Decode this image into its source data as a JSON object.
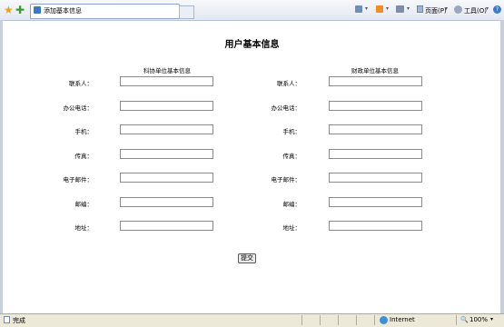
{
  "browser": {
    "tab_title": "添加基本信息",
    "page_menu": "页面(P)",
    "tools_menu": "工具(O)"
  },
  "page": {
    "title": "用户基本信息",
    "left_section": "科协单位基本信息",
    "right_section": "财政单位基本信息",
    "fields": [
      "联系人：",
      "办公电话：",
      "手机：",
      "传真：",
      "电子邮件：",
      "邮编：",
      "地址："
    ],
    "submit": "提交"
  },
  "status": {
    "left": "完成",
    "zone": "Internet",
    "zoom": "100%"
  }
}
